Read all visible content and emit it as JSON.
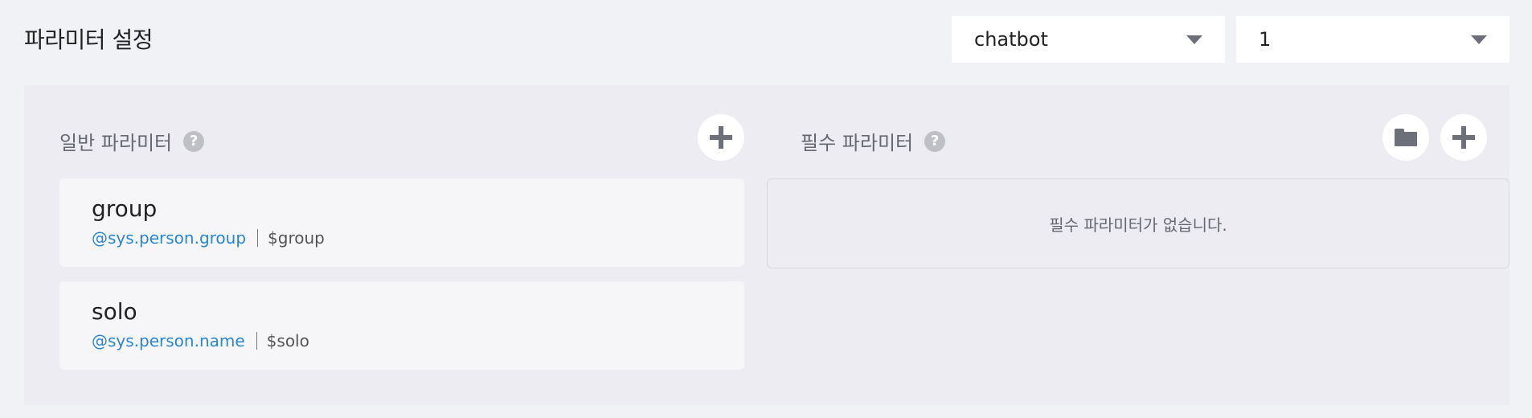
{
  "page_title": "파라미터 설정",
  "selects": {
    "bot": {
      "value": "chatbot"
    },
    "version": {
      "value": "1"
    }
  },
  "general": {
    "title": "일반 파라미터",
    "help_glyph": "?",
    "items": [
      {
        "name": "group",
        "entity": "@sys.person.group",
        "variable": "$group"
      },
      {
        "name": "solo",
        "entity": "@sys.person.name",
        "variable": "$solo"
      }
    ]
  },
  "required": {
    "title": "필수 파라미터",
    "help_glyph": "?",
    "empty_message": "필수 파라미터가 없습니다."
  },
  "icons": {
    "add": "plus-icon",
    "folder": "folder-icon",
    "help": "question-circle-icon",
    "dropdown": "caret-down-icon"
  },
  "colors": {
    "background": "#f1f2f6",
    "panel": "#ececf2",
    "entity_link": "#2b86d2",
    "icon": "#6d7079"
  }
}
